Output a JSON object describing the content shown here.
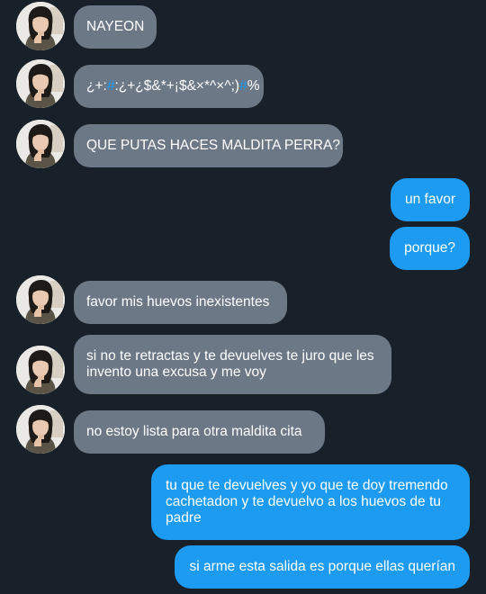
{
  "messages": [
    {
      "from": "them",
      "text": "NAYEON"
    },
    {
      "from": "them",
      "text_parts": [
        "¿+:",
        "#",
        ":¿+¿$&*+¡$&×*^×^;)",
        "#",
        "%"
      ]
    },
    {
      "from": "them",
      "text": "QUE PUTAS HACES MALDITA PERRA?"
    },
    {
      "from": "me",
      "text": "un favor"
    },
    {
      "from": "me",
      "text": "porque?"
    },
    {
      "from": "them",
      "text": "favor mis huevos inexistentes"
    },
    {
      "from": "them",
      "text": "si no te retractas y te devuelves te juro que les invento una excusa y me voy"
    },
    {
      "from": "them",
      "text": "no estoy lista para otra maldita cita"
    },
    {
      "from": "me",
      "text": "tu que te devuelves y yo que te doy tremendo cachetadon y te devuelvo a los huevos de tu padre"
    },
    {
      "from": "me",
      "text": "si arme esta salida es porque ellas querían"
    }
  ],
  "colors": {
    "background": "#18202a",
    "incoming_bubble": "#6c7886",
    "outgoing_bubble": "#1d9bf0",
    "hashtag": "#1d9bf0"
  },
  "icons": {
    "avatar": "profile-photo"
  }
}
